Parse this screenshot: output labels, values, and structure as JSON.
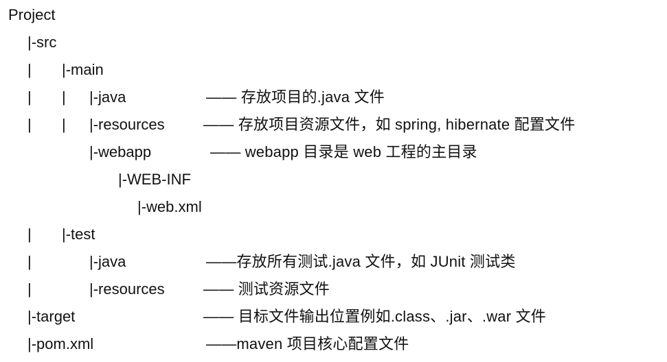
{
  "tree": {
    "rows": [
      {
        "pipes": [],
        "node": "Project",
        "desc": ""
      },
      {
        "pipes": [],
        "node": "|-src",
        "desc": ""
      },
      {
        "pipes": [
          "|"
        ],
        "node": "|-main",
        "desc": ""
      },
      {
        "pipes": [
          "|",
          "|"
        ],
        "node": "|-java",
        "desc": "——  存放项目的.java 文件"
      },
      {
        "pipes": [
          "|",
          "|"
        ],
        "node": "|-resources",
        "desc": "——  存放项目资源文件，如 spring, hibernate 配置文件"
      },
      {
        "pipes": [],
        "node": "|-webapp",
        "desc": "——  webapp 目录是 web 工程的主目录"
      },
      {
        "pipes": [],
        "node": "|-WEB-INF",
        "desc": ""
      },
      {
        "pipes": [],
        "node": "|-web.xml",
        "desc": ""
      },
      {
        "pipes": [
          "|"
        ],
        "node": "|-test",
        "desc": ""
      },
      {
        "pipes": [
          "|"
        ],
        "node": "|-java",
        "desc": "——存放所有测试.java 文件，如 JUnit 测试类"
      },
      {
        "pipes": [
          "|"
        ],
        "node": "|-resources",
        "desc": "——  测试资源文件"
      },
      {
        "pipes": [],
        "node": "|-target",
        "desc": "——  目标文件输出位置例如.class、.jar、.war 文件"
      },
      {
        "pipes": [],
        "node": "|-pom.xml",
        "desc": "——maven 项目核心配置文件"
      }
    ]
  }
}
